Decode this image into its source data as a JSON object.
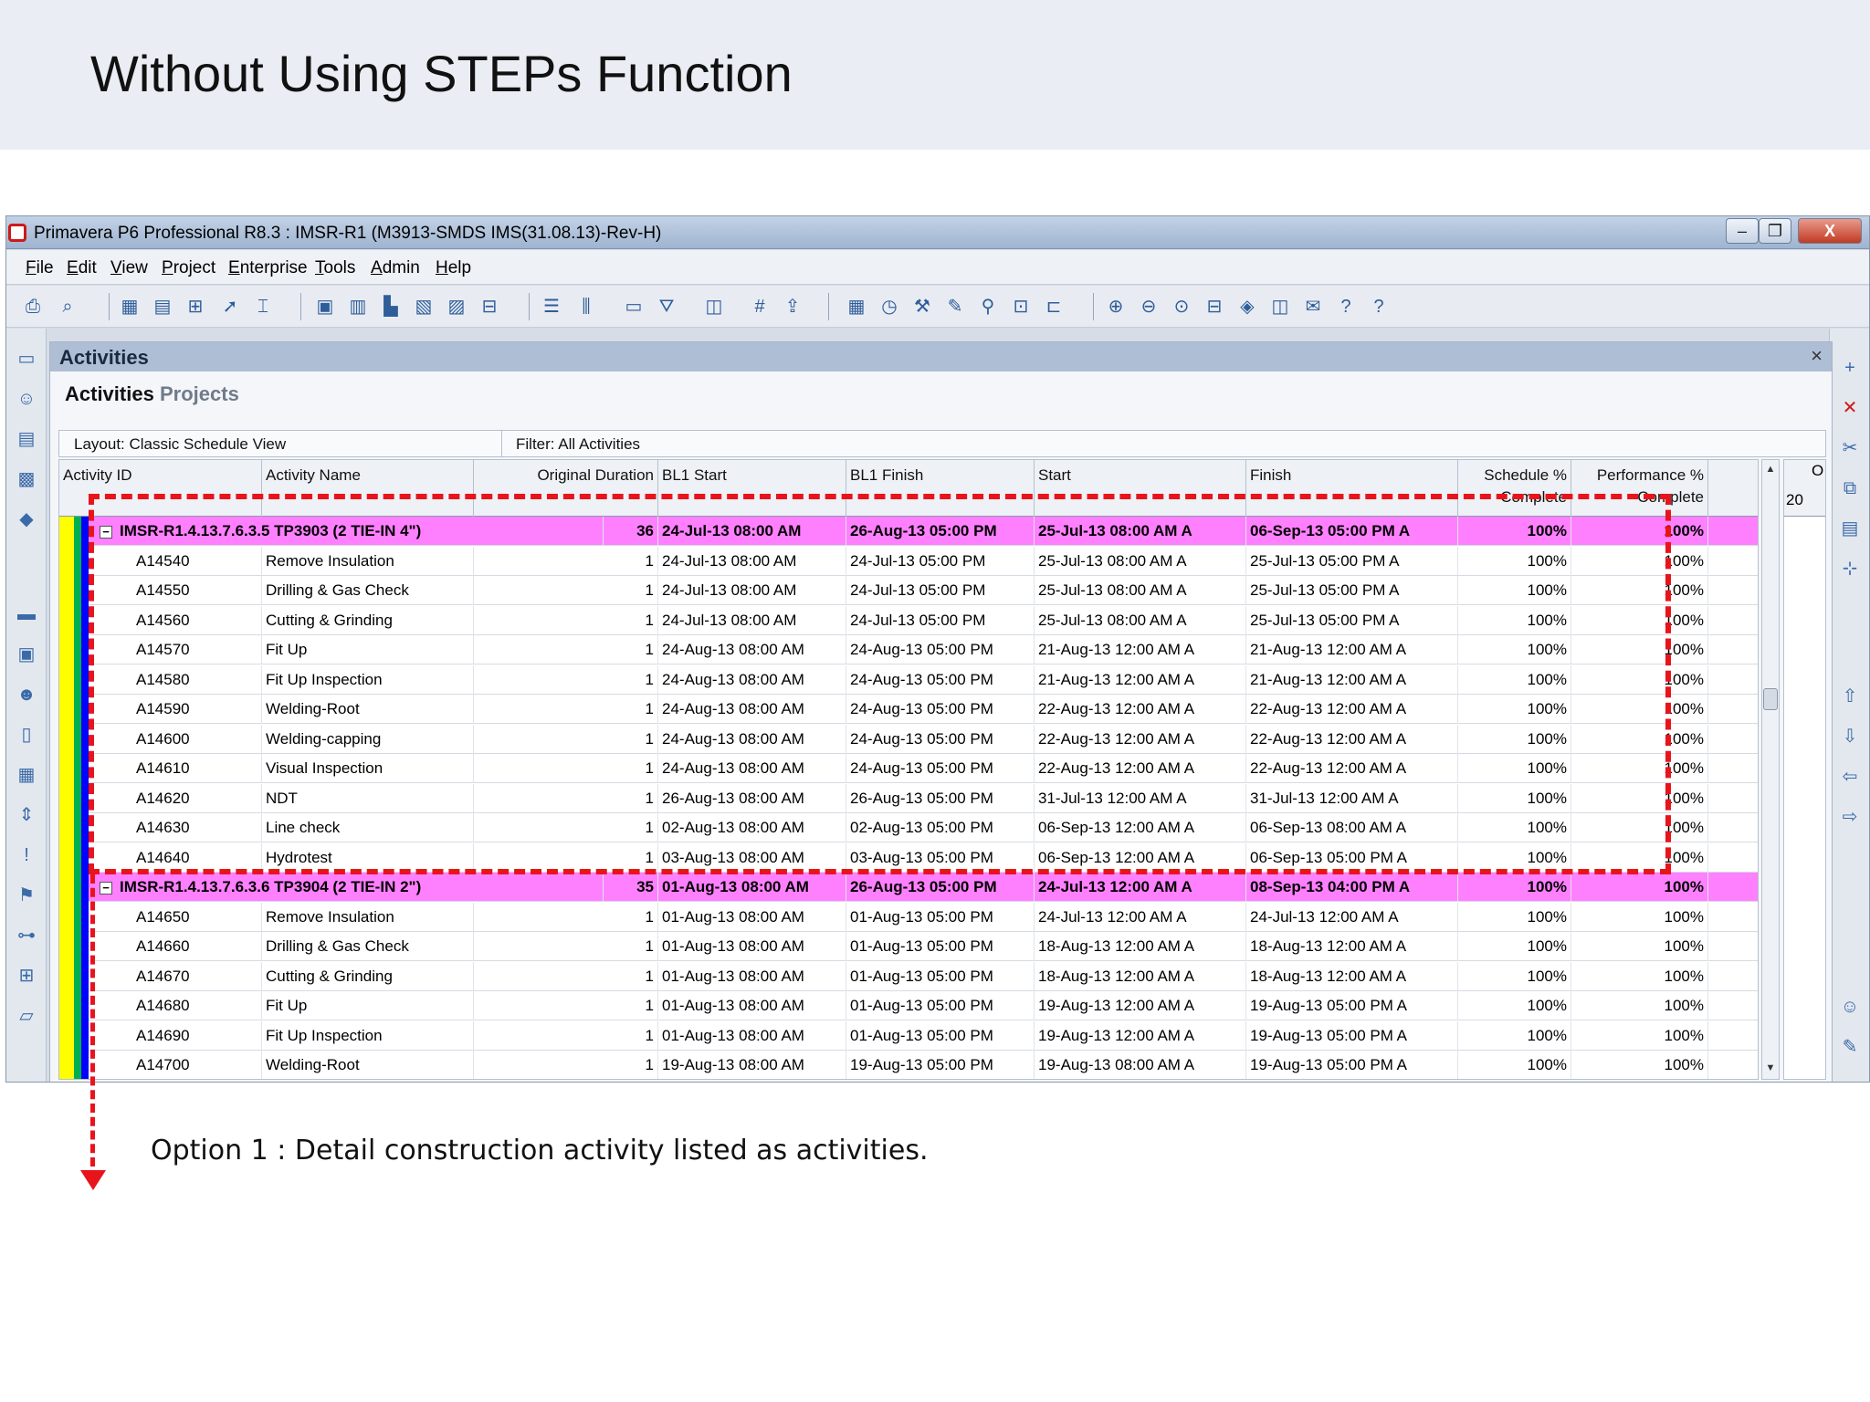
{
  "slide": {
    "title": "Without Using STEPs Function",
    "caption": "Option 1 : Detail construction activity listed as activities."
  },
  "app": {
    "window_title": "Primavera P6 Professional R8.3 : IMSR-R1 (M3913-SMDS IMS(31.08.13)-Rev-H)",
    "menu": [
      "File",
      "Edit",
      "View",
      "Project",
      "Enterprise",
      "Tools",
      "Admin",
      "Help"
    ],
    "window_buttons": {
      "minimize": "–",
      "restore": "❐",
      "close": "X"
    }
  },
  "panel": {
    "title": "Activities",
    "close": "×",
    "tabs": [
      "Activities",
      "Projects"
    ],
    "layout": "Layout: Classic Schedule View",
    "filter": "Filter: All Activities"
  },
  "columns": [
    {
      "key": "id",
      "label": "Activity ID"
    },
    {
      "key": "name",
      "label": "Activity Name"
    },
    {
      "key": "dur",
      "label": "Original Duration"
    },
    {
      "key": "bl1_start",
      "label": "BL1 Start"
    },
    {
      "key": "bl1_finish",
      "label": "BL1 Finish"
    },
    {
      "key": "start",
      "label": "Start"
    },
    {
      "key": "finish",
      "label": "Finish"
    },
    {
      "key": "sched",
      "label": "Schedule % Complete"
    },
    {
      "key": "perf",
      "label": "Performance % Complete"
    }
  ],
  "rows": [
    {
      "type": "wbs",
      "id": "IMSR-R1.4.13.7.6.3.5  TP3903 (2 TIE-IN 4\")",
      "name": "",
      "dur": "36",
      "bl1_start": "24-Jul-13 08:00 AM",
      "bl1_finish": "26-Aug-13 05:00 PM",
      "start": "25-Jul-13 08:00 AM A",
      "finish": "06-Sep-13 05:00 PM A",
      "sched": "100%",
      "perf": "100%"
    },
    {
      "type": "act",
      "id": "A14540",
      "name": "Remove Insulation",
      "dur": "1",
      "bl1_start": "24-Jul-13 08:00 AM",
      "bl1_finish": "24-Jul-13 05:00 PM",
      "start": "25-Jul-13 08:00 AM A",
      "finish": "25-Jul-13 05:00 PM A",
      "sched": "100%",
      "perf": "100%"
    },
    {
      "type": "act",
      "id": "A14550",
      "name": "Drilling & Gas Check",
      "dur": "1",
      "bl1_start": "24-Jul-13 08:00 AM",
      "bl1_finish": "24-Jul-13 05:00 PM",
      "start": "25-Jul-13 08:00 AM A",
      "finish": "25-Jul-13 05:00 PM A",
      "sched": "100%",
      "perf": "100%"
    },
    {
      "type": "act",
      "id": "A14560",
      "name": "Cutting & Grinding",
      "dur": "1",
      "bl1_start": "24-Jul-13 08:00 AM",
      "bl1_finish": "24-Jul-13 05:00 PM",
      "start": "25-Jul-13 08:00 AM A",
      "finish": "25-Jul-13 05:00 PM A",
      "sched": "100%",
      "perf": "100%"
    },
    {
      "type": "act",
      "id": "A14570",
      "name": "Fit Up",
      "dur": "1",
      "bl1_start": "24-Aug-13 08:00 AM",
      "bl1_finish": "24-Aug-13 05:00 PM",
      "start": "21-Aug-13 12:00 AM A",
      "finish": "21-Aug-13 12:00 AM A",
      "sched": "100%",
      "perf": "100%"
    },
    {
      "type": "act",
      "id": "A14580",
      "name": "Fit Up Inspection",
      "dur": "1",
      "bl1_start": "24-Aug-13 08:00 AM",
      "bl1_finish": "24-Aug-13 05:00 PM",
      "start": "21-Aug-13 12:00 AM A",
      "finish": "21-Aug-13 12:00 AM A",
      "sched": "100%",
      "perf": "100%"
    },
    {
      "type": "act",
      "id": "A14590",
      "name": "Welding-Root",
      "dur": "1",
      "bl1_start": "24-Aug-13 08:00 AM",
      "bl1_finish": "24-Aug-13 05:00 PM",
      "start": "22-Aug-13 12:00 AM A",
      "finish": "22-Aug-13 12:00 AM A",
      "sched": "100%",
      "perf": "100%"
    },
    {
      "type": "act",
      "id": "A14600",
      "name": "Welding-capping",
      "dur": "1",
      "bl1_start": "24-Aug-13 08:00 AM",
      "bl1_finish": "24-Aug-13 05:00 PM",
      "start": "22-Aug-13 12:00 AM A",
      "finish": "22-Aug-13 12:00 AM A",
      "sched": "100%",
      "perf": "100%"
    },
    {
      "type": "act",
      "id": "A14610",
      "name": "Visual Inspection",
      "dur": "1",
      "bl1_start": "24-Aug-13 08:00 AM",
      "bl1_finish": "24-Aug-13 05:00 PM",
      "start": "22-Aug-13 12:00 AM A",
      "finish": "22-Aug-13 12:00 AM A",
      "sched": "100%",
      "perf": "100%"
    },
    {
      "type": "act",
      "id": "A14620",
      "name": "NDT",
      "dur": "1",
      "bl1_start": "26-Aug-13 08:00 AM",
      "bl1_finish": "26-Aug-13 05:00 PM",
      "start": "31-Jul-13 12:00 AM A",
      "finish": "31-Jul-13 12:00 AM A",
      "sched": "100%",
      "perf": "100%"
    },
    {
      "type": "act",
      "id": "A14630",
      "name": "Line check",
      "dur": "1",
      "bl1_start": "02-Aug-13 08:00 AM",
      "bl1_finish": "02-Aug-13 05:00 PM",
      "start": "06-Sep-13 12:00 AM A",
      "finish": "06-Sep-13 08:00 AM A",
      "sched": "100%",
      "perf": "100%"
    },
    {
      "type": "act",
      "id": "A14640",
      "name": "Hydrotest",
      "dur": "1",
      "bl1_start": "03-Aug-13 08:00 AM",
      "bl1_finish": "03-Aug-13 05:00 PM",
      "start": "06-Sep-13 12:00 AM A",
      "finish": "06-Sep-13 05:00 PM A",
      "sched": "100%",
      "perf": "100%"
    },
    {
      "type": "wbs",
      "id": "IMSR-R1.4.13.7.6.3.6  TP3904 (2 TIE-IN 2\")",
      "name": "",
      "dur": "35",
      "bl1_start": "01-Aug-13 08:00 AM",
      "bl1_finish": "26-Aug-13 05:00 PM",
      "start": "24-Jul-13 12:00 AM A",
      "finish": "08-Sep-13 04:00 PM A",
      "sched": "100%",
      "perf": "100%"
    },
    {
      "type": "act",
      "id": "A14650",
      "name": "Remove Insulation",
      "dur": "1",
      "bl1_start": "01-Aug-13 08:00 AM",
      "bl1_finish": "01-Aug-13 05:00 PM",
      "start": "24-Jul-13 12:00 AM A",
      "finish": "24-Jul-13 12:00 AM A",
      "sched": "100%",
      "perf": "100%"
    },
    {
      "type": "act",
      "id": "A14660",
      "name": "Drilling & Gas Check",
      "dur": "1",
      "bl1_start": "01-Aug-13 08:00 AM",
      "bl1_finish": "01-Aug-13 05:00 PM",
      "start": "18-Aug-13 12:00 AM A",
      "finish": "18-Aug-13 12:00 AM A",
      "sched": "100%",
      "perf": "100%"
    },
    {
      "type": "act",
      "id": "A14670",
      "name": "Cutting & Grinding",
      "dur": "1",
      "bl1_start": "01-Aug-13 08:00 AM",
      "bl1_finish": "01-Aug-13 05:00 PM",
      "start": "18-Aug-13 12:00 AM A",
      "finish": "18-Aug-13 12:00 AM A",
      "sched": "100%",
      "perf": "100%"
    },
    {
      "type": "act",
      "id": "A14680",
      "name": "Fit Up",
      "dur": "1",
      "bl1_start": "01-Aug-13 08:00 AM",
      "bl1_finish": "01-Aug-13 05:00 PM",
      "start": "19-Aug-13 12:00 AM A",
      "finish": "19-Aug-13 05:00 PM A",
      "sched": "100%",
      "perf": "100%"
    },
    {
      "type": "act",
      "id": "A14690",
      "name": "Fit Up Inspection",
      "dur": "1",
      "bl1_start": "01-Aug-13 08:00 AM",
      "bl1_finish": "01-Aug-13 05:00 PM",
      "start": "19-Aug-13 12:00 AM A",
      "finish": "19-Aug-13 05:00 PM A",
      "sched": "100%",
      "perf": "100%"
    },
    {
      "type": "act",
      "id": "A14700",
      "name": "Welding-Root",
      "dur": "1",
      "bl1_start": "19-Aug-13 08:00 AM",
      "bl1_finish": "19-Aug-13 05:00 PM",
      "start": "19-Aug-13 08:00 AM A",
      "finish": "19-Aug-13 05:00 PM A",
      "sched": "100%",
      "perf": "100%"
    }
  ],
  "gantt": {
    "header_top": "O",
    "header_bottom": "20"
  },
  "colors": {
    "wbs_band": "#ff80ff",
    "highlight": "#e8141b",
    "wbs_stripes": [
      "#ffff00",
      "#ffff00",
      "#00b050",
      "#0000ff"
    ]
  }
}
